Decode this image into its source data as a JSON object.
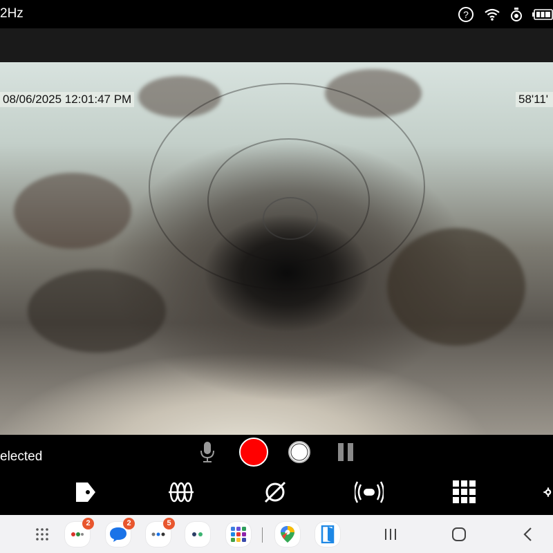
{
  "status_bar": {
    "left_text": "2Hz",
    "icons": [
      "help-circle-icon",
      "wifi-icon",
      "camera-device-icon",
      "battery-icon"
    ]
  },
  "camera": {
    "timestamp": "08/06/2025  12:01:47 PM",
    "distance": "58'11'"
  },
  "controls": {
    "selected_label": "elected",
    "icons": [
      "microphone-icon",
      "record-icon",
      "snapshot-icon",
      "pause-icon"
    ]
  },
  "toolbar": {
    "icons": [
      "partial-tool-icon",
      "tag-icon",
      "cable-coil-icon",
      "diameter-icon",
      "sonde-icon",
      "grid-icon",
      "settings-icon"
    ]
  },
  "nav_bar": {
    "apps": [
      {
        "name": "apps-drawer-icon"
      },
      {
        "name": "app-folder-1-icon",
        "badge": "2"
      },
      {
        "name": "messages-icon",
        "badge": "2"
      },
      {
        "name": "app-folder-2-icon",
        "badge": "5"
      },
      {
        "name": "app-folder-3-icon"
      },
      {
        "name": "app-folder-4-icon"
      },
      {
        "name": "maps-icon"
      },
      {
        "name": "door-app-icon"
      }
    ],
    "buttons": [
      "recents-button",
      "home-button",
      "back-button"
    ]
  },
  "colors": {
    "record": "#ff0000",
    "badge": "#e8562e",
    "nav_background": "#f2f2f4"
  }
}
